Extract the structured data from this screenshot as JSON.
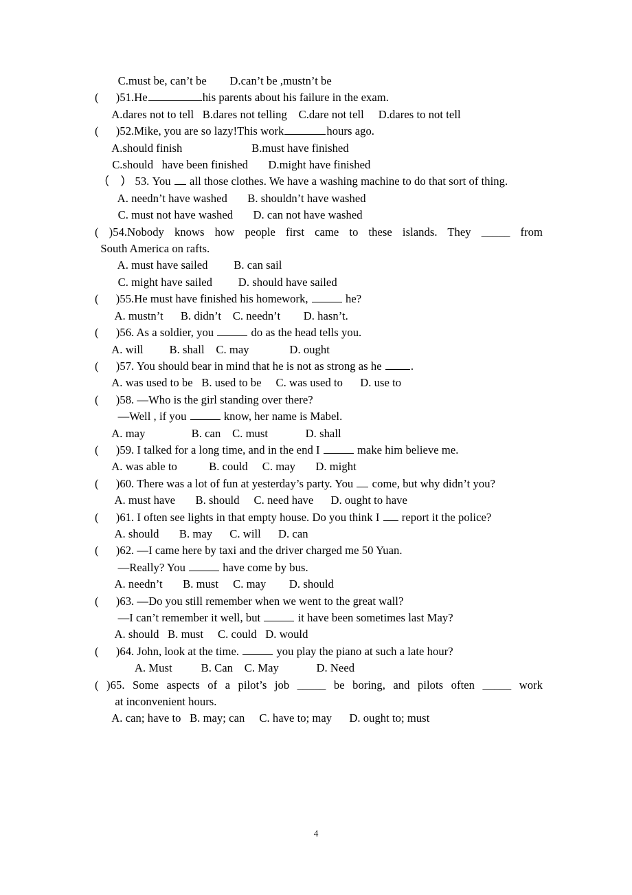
{
  "document": {
    "type": "worksheet",
    "subject": "English grammar - modal verbs multiple choice",
    "page_number": "4"
  },
  "lines": {
    "l01": "        C.must be, can’t be        D.can’t be ,mustn’t be",
    "q51_stem_a": "(      )51.He",
    "q51_stem_b": "his parents about his failure in the exam.",
    "q51_opts": "      A.dares not to tell   B.dares not telling    C.dare not tell     D.dares to not tell",
    "q52_stem_a": "(      )52.Mike, you are so lazy!This work",
    "q52_stem_b": "hours ago.",
    "q52_optsAB": "      A.should finish                        B.must have finished",
    "q52_optsCD": "      C.should   have been finished       D.might have finished",
    "q53_stem_a": " （    ） 53. You ",
    "q53_stem_b": " all those clothes. We have a washing machine to do that sort of thing.",
    "q53_optsAB": "        A. needn’t have washed       B. shouldn’t have washed",
    "q53_optsCD": "        C. must not have washed       D. can not have washed",
    "q54_stem_line1": "(      )54.Nobody knows how people first came to these islands. They _____ from",
    "q54_stem_line2": "  South America on rafts.",
    "q54_optsAB": "        A. must have sailed         B. can sail",
    "q54_optsCD": "        C. might have sailed         D. should have sailed",
    "q55_stem_a": "(      )55.He must have finished his homework, ",
    "q55_stem_b": " he?",
    "q55_opts": "       A. mustn’t      B. didn’t    C. needn’t        D. hasn’t.",
    "q56_stem_a": "(      )56. As a soldier, you ",
    "q56_stem_b": " do as the head tells you.",
    "q56_opts": "      A. will         B. shall    C. may              D. ought",
    "q57_stem_a": "(      )57. You should bear in mind that he is not as strong as he ",
    "q57_stem_b": ".",
    "q57_opts": "      A. was used to be   B. used to be     C. was used to      D. use to",
    "q58_stem": "(      )58. —Who is the girl standing over there?",
    "q58_stem2_a": "        —Well , if you ",
    "q58_stem2_b": " know, her name is Mabel.",
    "q58_opts": "      A. may                B. can    C. must             D. shall",
    "q59_stem_a": "(      )59. I talked for a long time, and in the end I ",
    "q59_stem_b": " make him believe me.",
    "q59_opts": "      A. was able to           B. could     C. may       D. might",
    "q60_stem_a": "(      )60. There was a lot of fun at yesterday’s party. You ",
    "q60_stem_b": " come, but why didn’t you?",
    "q60_opts": "       A. must have       B. should     C. need have      D. ought to have",
    "q61_stem_a": "(      )61. I often see lights in that empty house. Do you think I ",
    "q61_stem_b": " report it the police?",
    "q61_opts": "       A. should       B. may      C. will      D. can",
    "q62_stem": "(      )62. —I came here by taxi and the driver charged me 50 Yuan.",
    "q62_stem2_a": "        —Really? You ",
    "q62_stem2_b": " have come by bus.",
    "q62_opts": "       A. needn’t       B. must     C. may        D. should",
    "q63_stem": "(      )63. —Do you still remember when we went to the great wall?",
    "q63_stem2_a": "        —I can’t remember it well, but ",
    "q63_stem2_b": " it have been sometimes last May?",
    "q63_opts": "       A. should   B. must     C. could   D. would",
    "q64_stem_a": "(      )64. John, look at the time. ",
    "q64_stem_b": " you play the piano at such a late hour?",
    "q64_opts": "              A. Must          B. Can    C. May             D. Need",
    "q65_stem_line1": "(      )65. Some aspects of a pilot’s job _____ be boring, and pilots often _____ work",
    "q65_stem_line2": "       at inconvenient hours.",
    "q65_opts": "      A. can; have to   B. may; can     C. have to; may      D. ought to; must"
  },
  "page_footer": {
    "number": "4"
  }
}
